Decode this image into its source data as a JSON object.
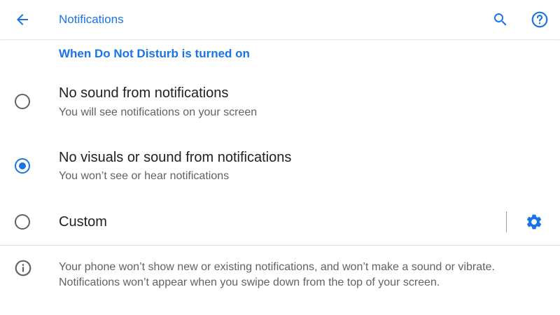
{
  "colors": {
    "accent": "#1a73e8",
    "primary_text": "#202124",
    "secondary_text": "#5f6368",
    "radio_off": "#5f6368",
    "divider": "#dadce0"
  },
  "header": {
    "title": "Notifications",
    "back_icon": "arrow-left-icon",
    "search_icon": "search-icon",
    "help_icon": "help-circle-icon"
  },
  "section": {
    "title": "When Do Not Disturb is turned on"
  },
  "options": [
    {
      "title": "No sound from notifications",
      "summary": "You will see notifications on your screen",
      "selected": false
    },
    {
      "title": "No visuals or sound from notifications",
      "summary": "You won’t see or hear notifications",
      "selected": true
    },
    {
      "title": "Custom",
      "selected": false,
      "settings_icon": "gear-icon"
    }
  ],
  "footer": {
    "info_icon": "info-icon",
    "text": "Your phone won’t show new or existing notifications, and won’t make a sound or vibrate. Notifications won’t appear when you swipe down from the top of your screen."
  }
}
